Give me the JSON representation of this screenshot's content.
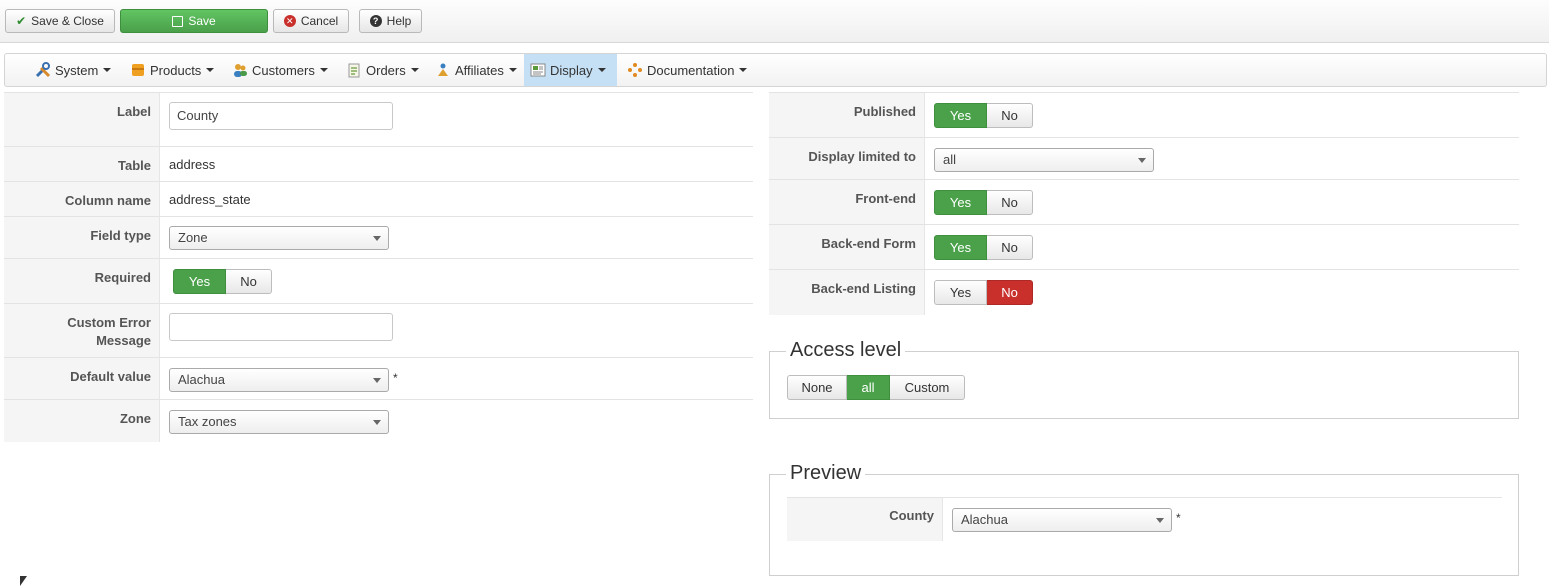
{
  "toolbar": {
    "save_close": "Save & Close",
    "save": "Save",
    "cancel": "Cancel",
    "help": "Help"
  },
  "menu": [
    {
      "label": "System",
      "icon": "tools-icon"
    },
    {
      "label": "Products",
      "icon": "products-icon"
    },
    {
      "label": "Customers",
      "icon": "customers-icon"
    },
    {
      "label": "Orders",
      "icon": "orders-icon"
    },
    {
      "label": "Affiliates",
      "icon": "affiliates-icon"
    },
    {
      "label": "Display",
      "icon": "display-icon",
      "active": true
    },
    {
      "label": "Documentation",
      "icon": "documentation-icon"
    }
  ],
  "left_form": {
    "label": {
      "label": "Label",
      "value": "County"
    },
    "table": {
      "label": "Table",
      "value": "address"
    },
    "column_name": {
      "label": "Column name",
      "value": "address_state"
    },
    "field_type": {
      "label": "Field type",
      "value": "Zone"
    },
    "required": {
      "label": "Required",
      "yes": "Yes",
      "no": "No",
      "selected": "Yes"
    },
    "custom_error": {
      "label_line1": "Custom Error",
      "label_line2": "Message",
      "value": ""
    },
    "default_value": {
      "label": "Default value",
      "value": "Alachua",
      "marker": "*"
    },
    "zone": {
      "label": "Zone",
      "value": "Tax zones"
    }
  },
  "right_form": {
    "published": {
      "label": "Published",
      "yes": "Yes",
      "no": "No",
      "selected": "Yes"
    },
    "display_limited": {
      "label": "Display limited to",
      "value": "all"
    },
    "frontend": {
      "label": "Front-end",
      "yes": "Yes",
      "no": "No",
      "selected": "Yes"
    },
    "backend_form": {
      "label": "Back-end Form",
      "yes": "Yes",
      "no": "No",
      "selected": "Yes"
    },
    "backend_listing": {
      "label": "Back-end Listing",
      "yes": "Yes",
      "no": "No",
      "selected": "No"
    }
  },
  "access_level": {
    "title": "Access level",
    "options": [
      "None",
      "all",
      "Custom"
    ],
    "selected": "all"
  },
  "preview": {
    "title": "Preview",
    "field_label": "County",
    "value": "Alachua",
    "marker": "*"
  },
  "colors": {
    "green": "#4aa14a",
    "red": "#c9302c",
    "active_menu": "#c5e0f5"
  }
}
